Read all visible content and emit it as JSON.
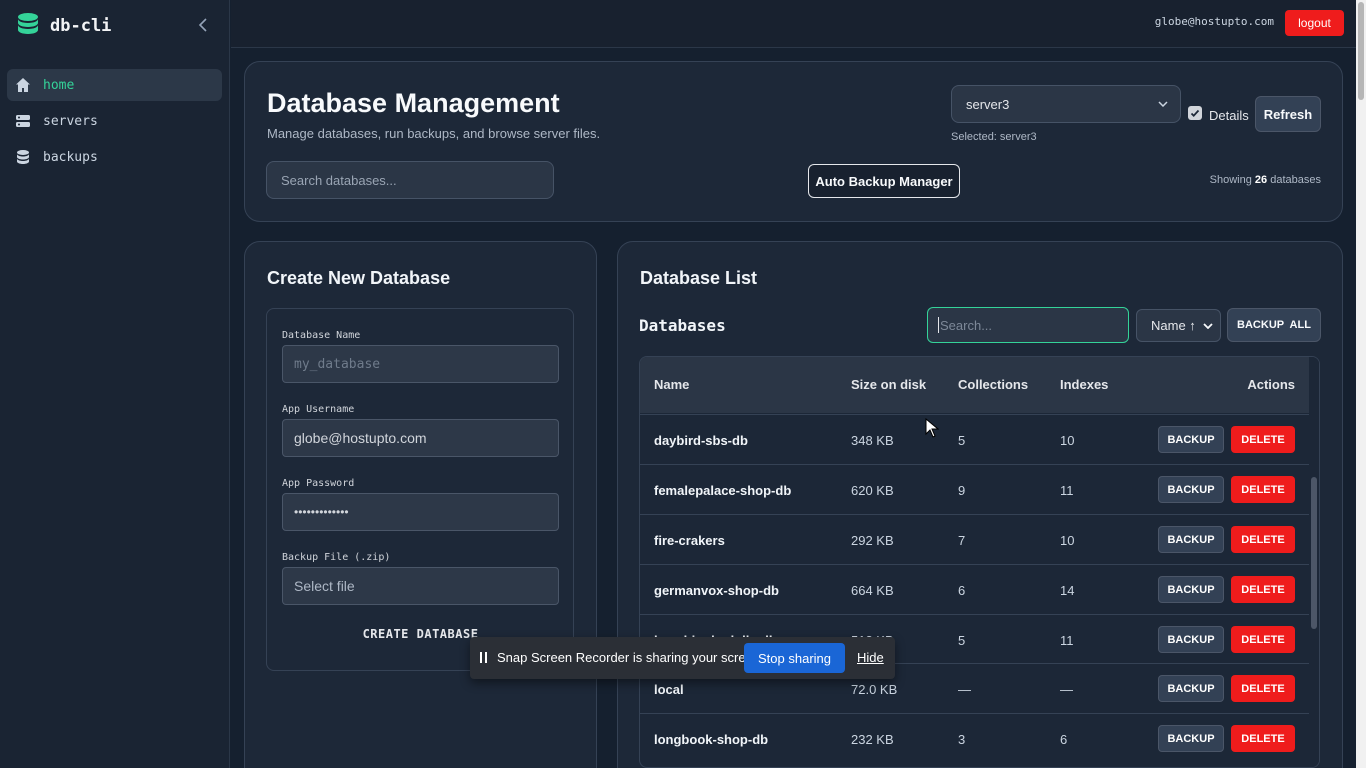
{
  "app": {
    "name": "db-cli"
  },
  "sidebar": {
    "items": [
      {
        "label": "home",
        "icon": "home-icon",
        "active": true
      },
      {
        "label": "servers",
        "icon": "server-icon",
        "active": false
      },
      {
        "label": "backups",
        "icon": "database-icon",
        "active": false
      }
    ]
  },
  "topbar": {
    "user_email": "globe@hostupto.com",
    "logout_label": "logout"
  },
  "header": {
    "title": "Database Management",
    "subtitle": "Manage databases, run backups, and browse server files.",
    "server_select_value": "server3",
    "selected_text": "Selected: server3",
    "details_label": "Details",
    "details_checked": true,
    "refresh_label": "Refresh",
    "search_placeholder": "Search databases...",
    "auto_backup_label": "Auto Backup Manager",
    "showing_prefix": "Showing ",
    "showing_count": "26",
    "showing_suffix": " databases"
  },
  "create": {
    "title": "Create New Database",
    "db_name_label": "Database Name",
    "db_name_placeholder": "my_database",
    "username_label": "App Username",
    "username_value": "globe@hostupto.com",
    "password_label": "App Password",
    "password_value": "•••••••••••••",
    "backup_label": "Backup File (.zip)",
    "backup_value": "Select file",
    "submit_label": "CREATE DATABASE"
  },
  "list": {
    "title": "Database List",
    "subtitle": "Databases",
    "search_placeholder": "Search...",
    "sort_value": "Name ↑",
    "backup_all_label": "BACKUP ALL",
    "columns": [
      "Name",
      "Size on disk",
      "Collections",
      "Indexes",
      "Actions"
    ],
    "rows": [
      {
        "name": "daybird-sbs-db",
        "size": "348 KB",
        "collections": "5",
        "indexes": "10"
      },
      {
        "name": "femalepalace-shop-db",
        "size": "620 KB",
        "collections": "9",
        "indexes": "11"
      },
      {
        "name": "fire-crakers",
        "size": "292 KB",
        "collections": "7",
        "indexes": "10"
      },
      {
        "name": "germanvox-shop-db",
        "size": "664 KB",
        "collections": "6",
        "indexes": "14"
      },
      {
        "name": "kanchipoly-dolls-db",
        "size": "512 KB",
        "collections": "5",
        "indexes": "11"
      },
      {
        "name": "local",
        "size": "72.0 KB",
        "collections": "—",
        "indexes": "—"
      },
      {
        "name": "longbook-shop-db",
        "size": "232 KB",
        "collections": "3",
        "indexes": "6"
      }
    ],
    "backup_label": "BACKUP",
    "delete_label": "DELETE"
  },
  "toast": {
    "message": "Snap Screen Recorder is sharing your screen.",
    "stop_label": "Stop sharing",
    "hide_label": "Hide"
  },
  "colors": {
    "accent": "#34d399",
    "danger": "#ef1c1c",
    "primary": "#1a66d6",
    "background": "#15202f"
  }
}
